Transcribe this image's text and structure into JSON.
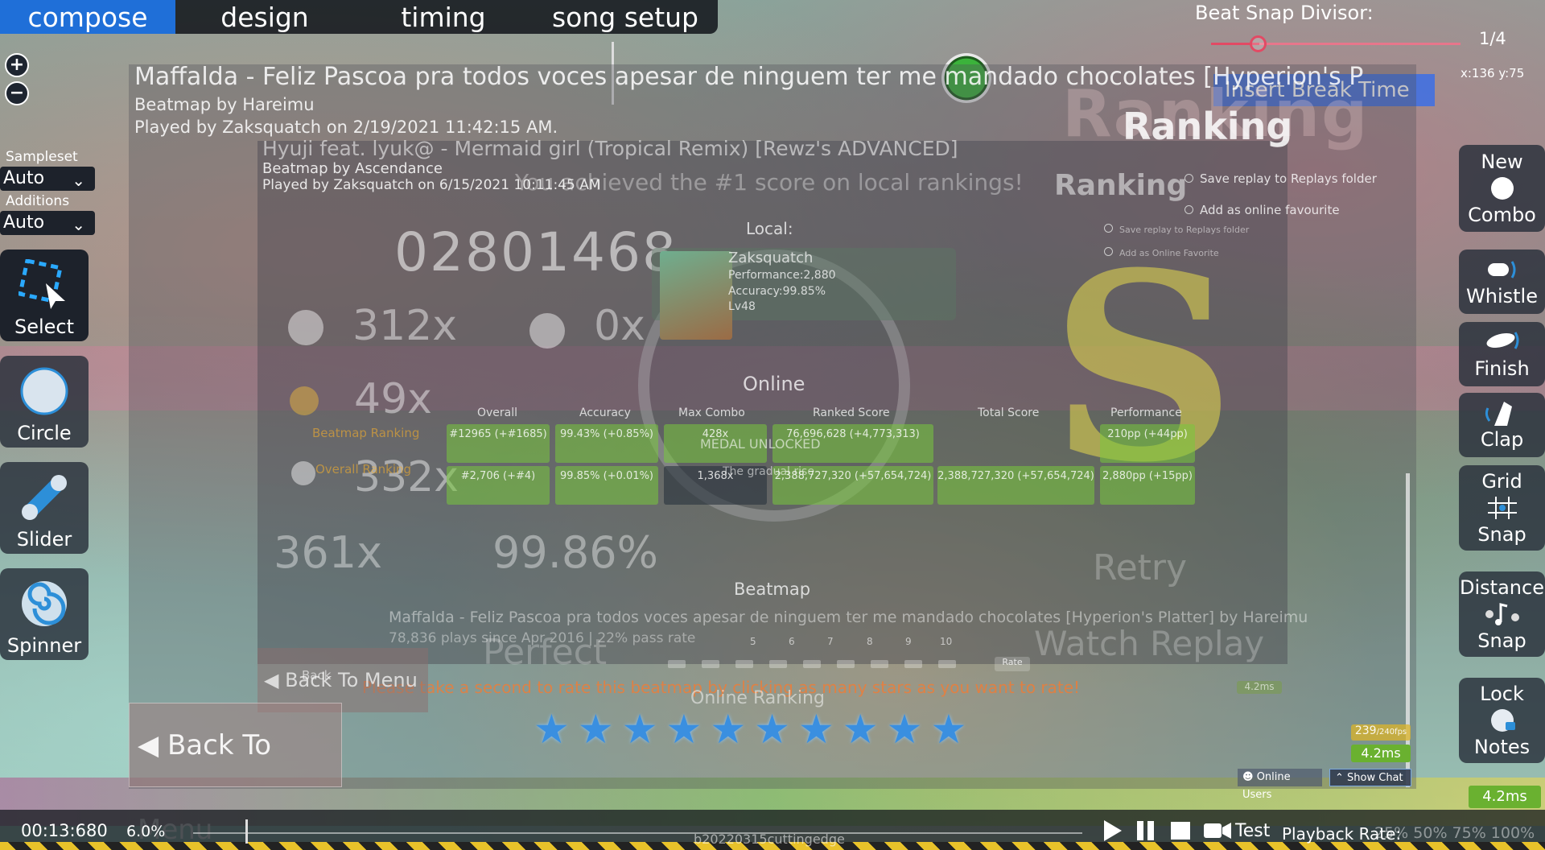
{
  "tabs": {
    "compose": "compose",
    "design": "design",
    "timing": "timing",
    "song_setup": "song setup"
  },
  "beat_snap": {
    "label": "Beat Snap Divisor:",
    "value": "1/4",
    "coords": "x:136 y:75"
  },
  "break_button": "Insert Break Time",
  "sidebar": {
    "sampleset_label": "Sampleset",
    "sampleset_value": "Auto",
    "additions_label": "Additions",
    "additions_value": "Auto",
    "tools": {
      "select": "Select",
      "circle": "Circle",
      "slider": "Slider",
      "spinner": "Spinner"
    }
  },
  "right_tools": {
    "new_combo_1": "New",
    "new_combo_2": "Combo",
    "whistle": "Whistle",
    "finish": "Finish",
    "clap": "Clap",
    "grid_snap_1": "Grid",
    "grid_snap_2": "Snap",
    "distance_snap_1": "Distance",
    "distance_snap_2": "Snap",
    "lock_notes_1": "Lock",
    "lock_notes_2": "Notes"
  },
  "ranking": {
    "title_main": "Maffalda - Feliz Pascoa pra todos voces apesar de ninguem ter me mandado chocolates [Hyperion's P",
    "by_1": "Beatmap by Hareimu",
    "played_1": "Played by Zaksquatch on 2/19/2021 11:42:15 AM.",
    "title_sub": "Hyuji feat. lyuk@ - Mermaid girl (Tropical Remix) [Rewz's ADVANCED]",
    "by_2": "Beatmap by Ascendance",
    "played_2": "Played by Zaksquatch on 6/15/2021 10:11:45 AM",
    "achieved": "You achieved the #1 score on local rankings!",
    "heading_big": "Ranking",
    "heading_small": "Ranking",
    "save_replay": "Save replay to Replays folder",
    "add_favourite": "Add as online favourite",
    "save_replay_small": "Save replay to Replays folder",
    "add_favourite_small": "Add as Online Favorite",
    "score": "02801468",
    "count_300": "312x",
    "count_miss": "0x",
    "count_100": "49x",
    "count_50": "332x",
    "grade": "S",
    "local_label": "Local:",
    "player_name": "Zaksquatch",
    "performance": "Performance:2,880",
    "accuracy": "Accuracy:99.85%",
    "level": "Lv48",
    "online": "Online",
    "headers": {
      "overall": "Overall",
      "accuracy": "Accuracy",
      "max_combo": "Max Combo",
      "ranked_score": "Ranked Score",
      "total_score": "Total Score",
      "performance": "Performance"
    },
    "beatmap_ranking": "Beatmap Ranking",
    "overall_ranking": "Overall Ranking",
    "cells_top": [
      "#12965 (+#1685)",
      "99.43% (+0.85%)",
      "428x",
      "76,696,628 (+4,773,313)",
      "210pp (+44pp)"
    ],
    "cells_bottom": [
      "#2,706 (+#4)",
      "99.85% (+0.01%)",
      "1,368x",
      "2,388,727,320 (+57,654,724)",
      "2,880pp (+15pp)"
    ],
    "medal": "MEDAL UNLOCKED",
    "gradual": "The gradual rise",
    "highest_combo": "361x",
    "accuracy_big": "99.86%",
    "retry": "Retry",
    "watch_replay": "Watch Replay",
    "perfect": "Perfect",
    "beatmap_label": "Beatmap",
    "beatmap_info": "Maffalda - Feliz Pascoa pra todos voces apesar de ninguem ter me mandado chocolates [Hyperion's Platter] by Hareimu",
    "beatmap_plays": "78,836 plays since Apr 2016 | 22% pass rate",
    "rate_prompt": "Please take a second to rate this beatmap by clicking as many stars as you want to rate!",
    "rate_button": "Rate",
    "scale": [
      "5",
      "6",
      "7",
      "8",
      "9",
      "10"
    ],
    "online_ranking": "Online Ranking",
    "back_small": "Back",
    "back_menu": "Back To Menu",
    "back_menu_big": "Back To Menu"
  },
  "status": {
    "ping_a": "4.2ms",
    "ping_b": "4.2ms",
    "ping_c": "4.2ms",
    "fps": "239",
    "fps_suffix": "/240fps",
    "online_users": "Online Users",
    "show_chat": "Show Chat"
  },
  "bottom": {
    "time": "00:13:680",
    "percent": "6.0%",
    "build": "b20220315cuttingedge",
    "test": "Test",
    "playback_label": "Playback Rate:",
    "playback_opts": "25% 50% 75% 100%"
  },
  "stars_count": 10,
  "colors": {
    "accent": "#1f6fd8",
    "beat_snap": "#e24a64",
    "star": "#3a8fe0",
    "grade": "#d2c850",
    "ping": "#6ab130"
  }
}
